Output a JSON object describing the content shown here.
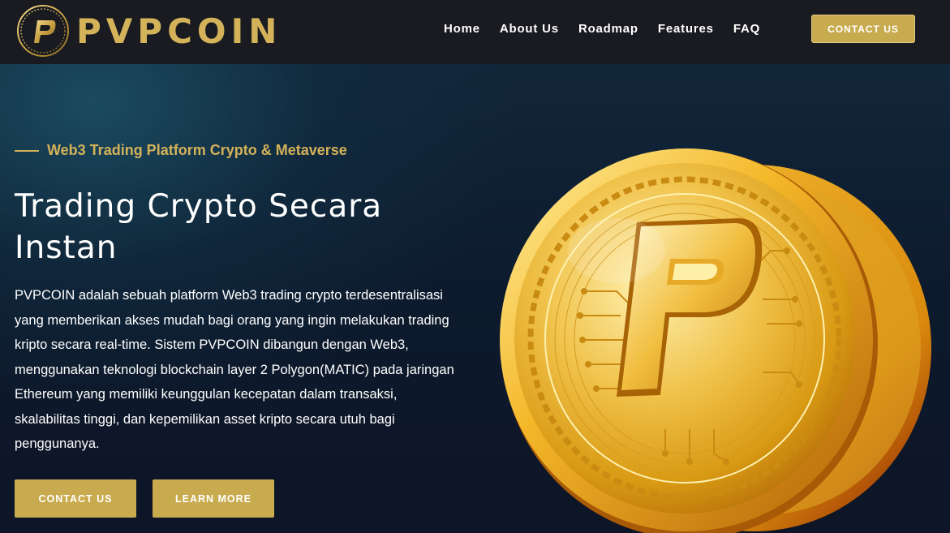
{
  "brand": {
    "name": "PVPCOIN",
    "logo_letter": "P",
    "accent_color": "#d4b25a"
  },
  "nav": {
    "items": [
      {
        "label": "Home"
      },
      {
        "label": "About Us"
      },
      {
        "label": "Roadmap"
      },
      {
        "label": "Features"
      },
      {
        "label": "FAQ"
      }
    ],
    "cta_label": "CONTACT US"
  },
  "hero": {
    "eyebrow": "Web3 Trading Platform Crypto & Metaverse",
    "title_line1": "Trading Crypto Secara",
    "title_line2": "Instan",
    "description": "PVPCOIN adalah sebuah platform Web3 trading crypto terdesentralisasi yang memberikan akses mudah bagi orang yang ingin melakukan trading kripto secara real-time. Sistem PVPCOIN dibangun dengan Web3, menggunakan teknologi blockchain layer 2 Polygon(MATIC) pada jaringan Ethereum yang memiliki keunggulan kecepatan dalam transaksi, skalabilitas tinggi, dan kepemilikan asset kripto secara utuh bagi penggunanya.",
    "primary_button": "CONTACT US",
    "secondary_button": "LEARN MORE",
    "illustration": "gold-coin-icon"
  },
  "colors": {
    "navbar_bg": "#191b21",
    "button_gold": "#c9ab4f",
    "hero_bg": "#0d1526"
  }
}
